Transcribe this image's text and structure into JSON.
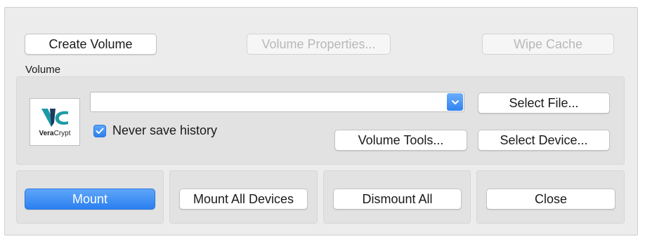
{
  "toolbar": {
    "create_volume": "Create Volume",
    "volume_properties": "Volume Properties...",
    "wipe_cache": "Wipe Cache"
  },
  "volume_section": {
    "label": "Volume",
    "logo_text_bold": "Vera",
    "logo_text_rest": "Crypt",
    "path_value": "",
    "select_file": "Select File...",
    "never_save_history": "Never save history",
    "never_save_history_checked": true,
    "volume_tools": "Volume Tools...",
    "select_device": "Select Device..."
  },
  "actions": {
    "mount": "Mount",
    "mount_all_devices": "Mount All Devices",
    "dismount_all": "Dismount All",
    "close": "Close"
  },
  "colors": {
    "accent": "#2b7ff0",
    "logo_teal": "#1e9aa5",
    "logo_navy": "#1c3a5e"
  },
  "icons": {
    "combo_arrow": "chevron-down-icon",
    "checkbox": "checkmark-icon",
    "logo": "veracrypt-logo"
  }
}
